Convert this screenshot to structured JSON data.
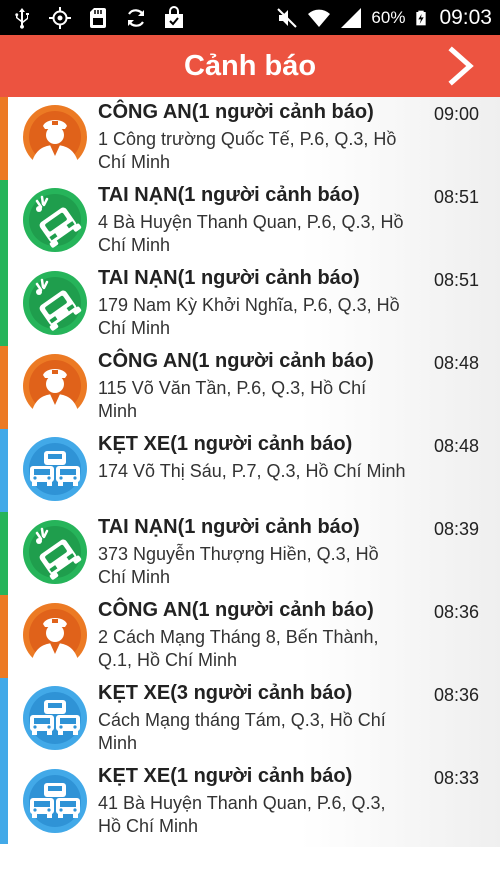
{
  "status_bar": {
    "left_icons": [
      "usb-icon",
      "gps-icon",
      "sd-card-icon",
      "sync-icon",
      "shopping-bag-icon"
    ],
    "right_icons": [
      "mute-icon",
      "wifi-icon",
      "signal-icon",
      "battery-icon"
    ],
    "battery_percent": "60%",
    "time": "09:03"
  },
  "header": {
    "title": "Cảnh báo",
    "next_icon": "chevron-right-icon",
    "color": "#ec5340"
  },
  "colors": {
    "police": "#ec7a24",
    "accident": "#26b45a",
    "traffic": "#42a9e8"
  },
  "alerts": [
    {
      "type": "police",
      "icon": "police-officer-icon",
      "title": "CÔNG AN(1 người cảnh báo)",
      "time": "09:00",
      "address": "1 Công trường Quốc Tế, P.6, Q.3, Hồ Chí Minh"
    },
    {
      "type": "accident",
      "icon": "car-crash-icon",
      "title": "TAI NẠN(1 người cảnh báo)",
      "time": "08:51",
      "address": "4 Bà Huyện Thanh Quan, P.6, Q.3, Hồ Chí Minh"
    },
    {
      "type": "accident",
      "icon": "car-crash-icon",
      "title": "TAI NẠN(1 người cảnh báo)",
      "time": "08:51",
      "address": "179 Nam Kỳ Khởi Nghĩa, P.6, Q.3, Hồ Chí Minh"
    },
    {
      "type": "police",
      "icon": "police-officer-icon",
      "title": "CÔNG AN(1 người cảnh báo)",
      "time": "08:48",
      "address": "115 Võ Văn Tần, P.6, Q.3, Hồ Chí Minh"
    },
    {
      "type": "traffic",
      "icon": "traffic-jam-icon",
      "title": "KẸT XE(1 người cảnh báo)",
      "time": "08:48",
      "address": "174 Võ Thị Sáu, P.7, Q.3, Hồ Chí Minh"
    },
    {
      "type": "accident",
      "icon": "car-crash-icon",
      "title": "TAI NẠN(1 người cảnh báo)",
      "time": "08:39",
      "address": "373 Nguyễn Thượng Hiền, Q.3, Hồ Chí Minh"
    },
    {
      "type": "police",
      "icon": "police-officer-icon",
      "title": "CÔNG AN(1 người cảnh báo)",
      "time": "08:36",
      "address": "2 Cách Mạng Tháng 8, Bến Thành, Q.1, Hồ Chí Minh"
    },
    {
      "type": "traffic",
      "icon": "traffic-jam-icon",
      "title": "KẸT XE(3 người cảnh báo)",
      "time": "08:36",
      "address": "Cách Mạng tháng Tám, Q.3, Hồ Chí Minh"
    },
    {
      "type": "traffic",
      "icon": "traffic-jam-icon",
      "title": "KẸT XE(1 người cảnh báo)",
      "time": "08:33",
      "address": "41 Bà Huyện Thanh Quan, P.6, Q.3, Hồ Chí Minh"
    }
  ]
}
